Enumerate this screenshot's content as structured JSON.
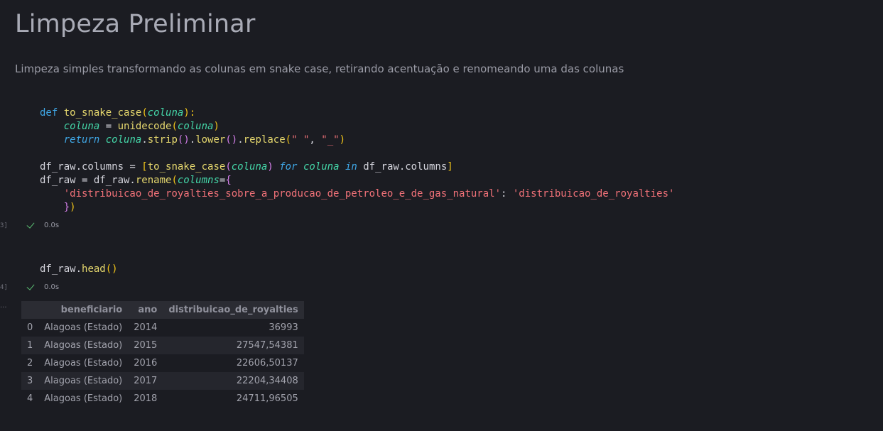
{
  "markdown": {
    "title": "Limpeza Preliminar",
    "description": "Limpeza simples transformando as colunas em snake case, retirando acentuação e renomeando uma das colunas"
  },
  "cells": [
    {
      "exec_count": "3]",
      "status": "0.0s",
      "code": {
        "l1_def": "def",
        "l1_fn": "to_snake_case",
        "l1_p1": "(",
        "l1_arg": "coluna",
        "l1_p2": "):",
        "l2_var": "coluna",
        "l2_eq": " = ",
        "l2_fn": "unidecode",
        "l2_p1": "(",
        "l2_arg": "coluna",
        "l2_p2": ")",
        "l3_ret": "return",
        "l3_var": "coluna",
        "l3_dot1": ".",
        "l3_m1": "strip",
        "l3_pp1": "()",
        "l3_dot2": ".",
        "l3_m2": "lower",
        "l3_pp2": "()",
        "l3_dot3": ".",
        "l3_m3": "replace",
        "l3_p1": "(",
        "l3_s1": "\" \"",
        "l3_comma": ", ",
        "l3_s2": "\"_\"",
        "l3_p2": ")",
        "l5_a": "df_raw.columns = ",
        "l5_b1": "[",
        "l5_fn": "to_snake_case",
        "l5_p1": "(",
        "l5_arg": "coluna",
        "l5_p2": ")",
        "l5_for": "for",
        "l5_var": "coluna",
        "l5_in": "in",
        "l5_rest": "df_raw.columns",
        "l5_b2": "]",
        "l6_a": "df_raw = df_raw.",
        "l6_fn": "rename",
        "l6_p1": "(",
        "l6_kw": "columns",
        "l6_eq": "=",
        "l6_b1": "{",
        "l7_s1": "'distribuicao_de_royalties_sobre_a_producao_de_petroleo_e_de_gas_natural'",
        "l7_colon": ": ",
        "l7_s2": "'distribuicao_de_royalties'",
        "l8_b2": "}",
        "l8_p2": ")"
      }
    },
    {
      "exec_count": "4]",
      "status": "0.0s",
      "code": {
        "l1_a": "df_raw.",
        "l1_fn": "head",
        "l1_p": "()"
      }
    }
  ],
  "output": {
    "ellipsis": "...",
    "columns": [
      "",
      "beneficiario",
      "ano",
      "distribuicao_de_royalties"
    ],
    "rows": [
      [
        "0",
        "Alagoas (Estado)",
        "2014",
        "36993"
      ],
      [
        "1",
        "Alagoas (Estado)",
        "2015",
        "27547,54381"
      ],
      [
        "2",
        "Alagoas (Estado)",
        "2016",
        "22606,50137"
      ],
      [
        "3",
        "Alagoas (Estado)",
        "2017",
        "22204,34408"
      ],
      [
        "4",
        "Alagoas (Estado)",
        "2018",
        "24711,96505"
      ]
    ]
  },
  "icons": {
    "status": "check-icon"
  },
  "colors": {
    "background": "#1b1c22",
    "success": "#5bbf73"
  }
}
